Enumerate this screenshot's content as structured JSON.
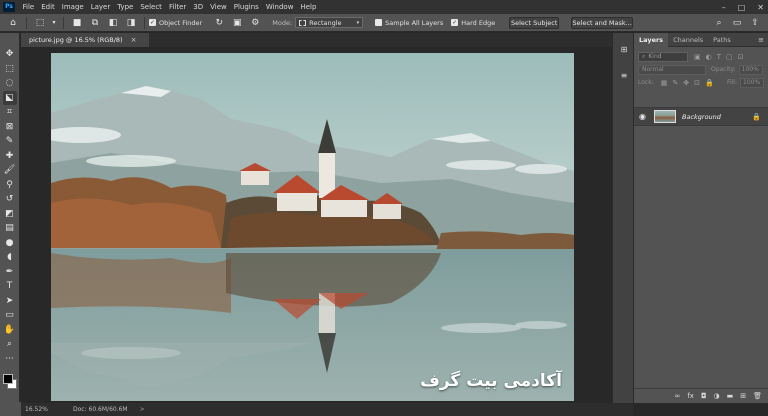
{
  "menubar": {
    "logo": "Ps",
    "items": [
      "File",
      "Edit",
      "Image",
      "Layer",
      "Type",
      "Select",
      "Filter",
      "3D",
      "View",
      "Plugins",
      "Window",
      "Help"
    ],
    "controls": [
      "–",
      "□",
      "✕"
    ]
  },
  "options": {
    "object_finder": "Object Finder",
    "mode_label": "Mode:",
    "mode_value": "Rectangle",
    "sample_all_layers": "Sample All Layers",
    "hard_edge": "Hard Edge",
    "select_subject": "Select Subject",
    "select_and_mask": "Select and Mask..."
  },
  "document": {
    "tab_title": "picture.jpg @ 16.5% (RGB/8)",
    "close": "×"
  },
  "canvas": {
    "watermark": "آکادمی بیت گرف"
  },
  "layers_panel": {
    "tabs": [
      "Layers",
      "Channels",
      "Paths"
    ],
    "kind": "Kind",
    "blend_mode": "Normal",
    "opacity_label": "Opacity:",
    "opacity_value": "100%",
    "lock_label": "Lock:",
    "fill_label": "Fill:",
    "fill_value": "100%",
    "layer_name": "Background"
  },
  "status": {
    "zoom": "16.52%",
    "doc": "Doc: 60.6M/60.6M",
    "arrow": ">"
  }
}
